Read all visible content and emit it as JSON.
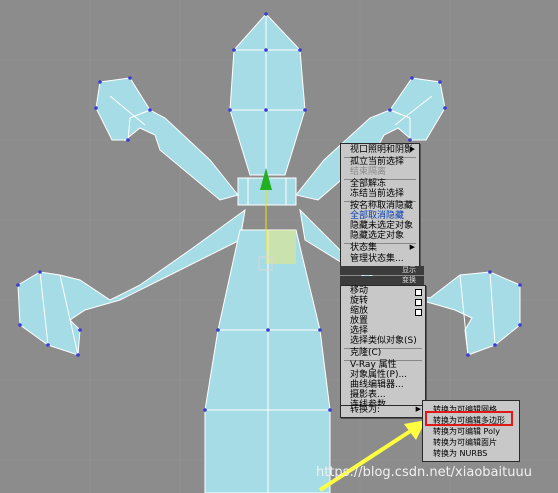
{
  "quad_menu_upper": [
    "视口照明和阴影",
    "孤立当前选择",
    "结束隔离",
    "全部解冻",
    "冻结当前选择",
    "按名称取消隐藏",
    "全部取消隐藏",
    "隐藏未选定对象",
    "隐藏选定对象",
    "状态集",
    "管理状态集..."
  ],
  "band_labels": {
    "display": "显示",
    "transform": "变换"
  },
  "quad_menu_lower": [
    "移动",
    "旋转",
    "缩放",
    "放置",
    "选择",
    "选择类似对象(S)",
    "克隆(C)",
    "V-Ray 属性",
    "对象属性(P)...",
    "曲线编辑器...",
    "摄影表...",
    "连线参数...",
    "转换为:"
  ],
  "convert_submenu": [
    "转换为可编辑网格",
    "转换为可编辑多边形",
    "转换为可编辑 Poly",
    "转换为可编辑面片",
    "转换为 NURBS"
  ],
  "watermark": "https://blog.csdn.net/xiaobaituuu",
  "colors": {
    "mesh": "#a6dce6",
    "vertex": "#3a3ad8",
    "highlight": "#e01818",
    "arrow": "#ffff40"
  }
}
